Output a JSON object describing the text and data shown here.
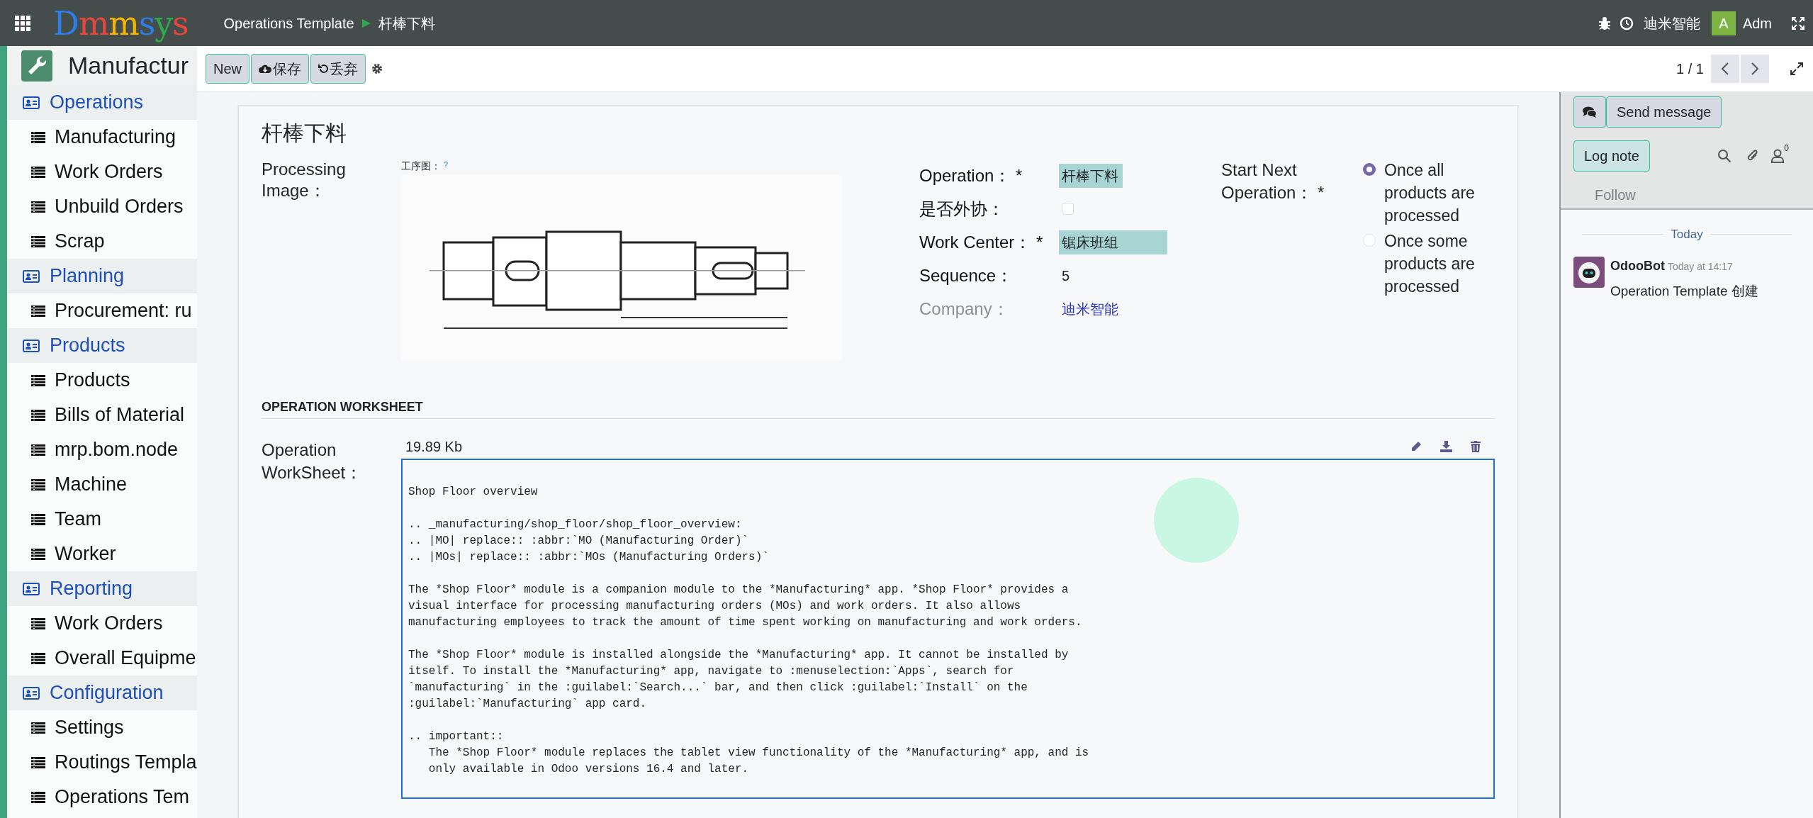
{
  "top_bar": {
    "logo": "Dmmsys",
    "breadcrumb": [
      "Operations Template",
      "杆棒下料"
    ],
    "company": "迪米智能",
    "user_initial": "A",
    "user": "Adm"
  },
  "app_title": "Manufactur",
  "sidebar": [
    {
      "label": "Operations",
      "items": [
        "Manufacturing",
        "Work Orders",
        "Unbuild Orders",
        "Scrap"
      ]
    },
    {
      "label": "Planning",
      "items": [
        "Procurement: ru"
      ]
    },
    {
      "label": "Products",
      "items": [
        "Products",
        "Bills of Material",
        "mrp.bom.node",
        "Machine",
        "Team",
        "Worker"
      ]
    },
    {
      "label": "Reporting",
      "items": [
        "Work Orders",
        "Overall Equipme"
      ]
    },
    {
      "label": "Configuration",
      "items": [
        "Settings",
        "Routings Templa",
        "Operations Tem"
      ]
    }
  ],
  "toolbar": {
    "buttons": [
      "New",
      "保存",
      "丢弃"
    ],
    "pager": "1 / 1"
  },
  "form": {
    "title": "杆棒下料",
    "image_field": {
      "label": "Processing Image：",
      "caption": "工序图：",
      "help": "?"
    },
    "fields": [
      {
        "kind": "text",
        "label": "Operation： *",
        "value": "杆棒下料",
        "highlighted": true,
        "readonly": false
      },
      {
        "kind": "checkbox",
        "label": "是否外协：",
        "checked": false,
        "readonly": false
      },
      {
        "kind": "text",
        "label": "Work Center： *",
        "value": "锯床班组",
        "highlighted": true,
        "readonly": false
      },
      {
        "kind": "text",
        "label": "Sequence：",
        "value": "5",
        "highlighted": false,
        "readonly": false
      },
      {
        "kind": "link",
        "label": "Company：",
        "value": "迪米智能",
        "readonly": true
      }
    ],
    "start_next": {
      "label": "Start Next Operation： *",
      "options": [
        {
          "label": "Once all products are processed",
          "selected": true
        },
        {
          "label": "Once some products are processed",
          "selected": false
        }
      ]
    },
    "section_title": "OPERATION WORKSHEET",
    "worksheet": {
      "label": "Operation WorkSheet：",
      "size": "19.89 Kb",
      "text": "Shop Floor overview\n\n.. _manufacturing/shop_floor/shop_floor_overview:\n.. |MO| replace:: :abbr:`MO (Manufacturing Order)`\n.. |MOs| replace:: :abbr:`MOs (Manufacturing Orders)`\n\nThe *Shop Floor* module is a companion module to the *Manufacturing* app. *Shop Floor* provides a\nvisual interface for processing manufacturing orders (MOs) and work orders. It also allows\nmanufacturing employees to track the amount of time spent working on manufacturing and work orders.\n\nThe *Shop Floor* module is installed alongside the *Manufacturing* app. It cannot be installed by\nitself. To install the *Manufacturing* app, navigate to :menuselection:`Apps`, search for\n`manufacturing` in the :guilabel:`Search...` bar, and then click :guilabel:`Install` on the\n:guilabel:`Manufacturing` app card.\n\n.. important::\n   The *Shop Floor* module replaces the tablet view functionality of the *Manufacturing* app, and is\n   only available in Odoo versions 16.4 and later."
    }
  },
  "chatter": {
    "send_message": "Send message",
    "log_note": "Log note",
    "followers": "0",
    "follow": "Follow",
    "date": "Today",
    "messages": [
      {
        "author": "OdooBot",
        "time": "Today at 14:17",
        "body": "Operation Template 创建"
      }
    ]
  }
}
